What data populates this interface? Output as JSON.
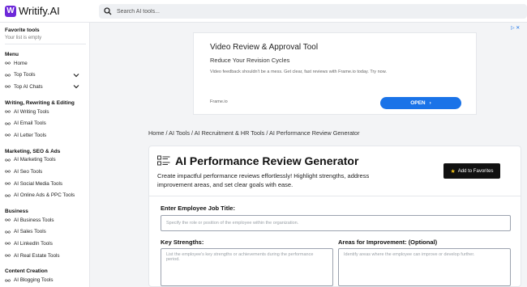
{
  "header": {
    "brand_mark": "W",
    "brand": "Writify.AI",
    "search_placeholder": "Search AI tools..."
  },
  "sidebar": {
    "favorites_title": "Favorite tools",
    "favorites_empty": "Your list is empty",
    "sections": [
      {
        "title": "Menu",
        "items": [
          {
            "label": "Home",
            "icon": "infinity-icon"
          },
          {
            "label": "Top Tools",
            "icon": "infinity-icon",
            "expand": true
          },
          {
            "label": "Top AI Chats",
            "icon": "infinity-icon",
            "expand": true
          }
        ]
      },
      {
        "title": "Writing, Rewriting & Editing",
        "items": [
          {
            "label": "AI Writing Tools",
            "icon": "infinity-icon"
          },
          {
            "label": "AI Email Tools",
            "icon": "infinity-icon"
          },
          {
            "label": "AI Letter Tools",
            "icon": "infinity-icon"
          }
        ]
      },
      {
        "title": "Marketing, SEO & Ads",
        "items": [
          {
            "label": "AI Marketing Tools",
            "icon": "infinity-icon"
          },
          {
            "label": "AI Seo Tools",
            "icon": "infinity-icon"
          },
          {
            "label": "AI Social Media Tools",
            "icon": "infinity-icon"
          },
          {
            "label": "AI Online Ads & PPC Tools",
            "icon": "infinity-icon"
          }
        ]
      },
      {
        "title": "Business",
        "items": [
          {
            "label": "AI Business Tools",
            "icon": "infinity-icon"
          },
          {
            "label": "AI Sales Tools",
            "icon": "infinity-icon"
          },
          {
            "label": "AI LinkedIn Tools",
            "icon": "infinity-icon"
          },
          {
            "label": "AI Real Estate Tools",
            "icon": "infinity-icon"
          }
        ]
      },
      {
        "title": "Content Creation",
        "items": [
          {
            "label": "AI Blogging Tools",
            "icon": "infinity-icon"
          }
        ]
      }
    ]
  },
  "ad": {
    "title": "Video Review & Approval Tool",
    "subtitle": "Reduce Your Revision Cycles",
    "description": "Video feedback shouldn't be a mess. Get clear, fast reviews with Frame.io today. Try now.",
    "domain": "Frame.io",
    "cta": "OPEN"
  },
  "breadcrumb": {
    "home": "Home",
    "sep": " / ",
    "l1": "AI Tools",
    "l2": "AI Recruitment & HR Tools",
    "current": "AI Performance Review Generator"
  },
  "tool": {
    "title": "AI Performance Review Generator",
    "description": "Create impactful performance reviews effortlessly! Highlight strengths, address improvement areas, and set clear goals with ease.",
    "favorite_button": "Add to Favorites",
    "job_title_label": "Enter Employee Job Title:",
    "job_title_placeholder": "Specify the role or position of the employee within the organization.",
    "strengths_label": "Key Strengths:",
    "strengths_placeholder": "List the employee's key strengths or achievements during the performance period.",
    "improvement_label": "Areas for Improvement: (Optional)",
    "improvement_placeholder": "Identify areas where the employee can improve or develop further."
  },
  "colors": {
    "brand": "#6d28d9",
    "cta_blue": "#1a73e8",
    "favorite_button_bg": "#111111",
    "star": "#f5c518"
  }
}
